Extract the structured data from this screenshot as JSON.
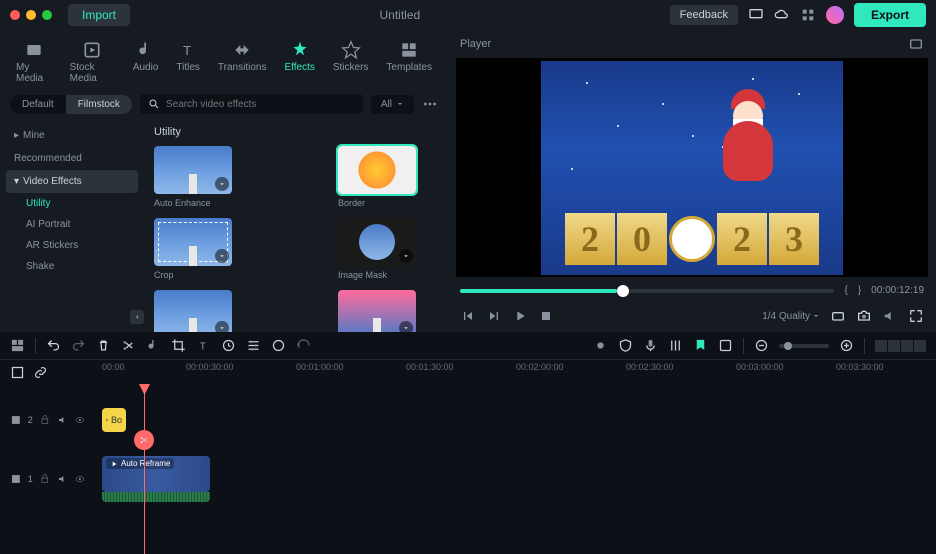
{
  "titlebar": {
    "import": "Import",
    "title": "Untitled",
    "feedback": "Feedback",
    "export": "Export"
  },
  "media_tabs": [
    {
      "label": "My Media"
    },
    {
      "label": "Stock Media"
    },
    {
      "label": "Audio"
    },
    {
      "label": "Titles"
    },
    {
      "label": "Transitions"
    },
    {
      "label": "Effects"
    },
    {
      "label": "Stickers"
    },
    {
      "label": "Templates"
    }
  ],
  "subbar": {
    "default": "Default",
    "filmstock": "Filmstock",
    "search_placeholder": "Search video effects",
    "filter": "All"
  },
  "sidebar": {
    "items": [
      "Mine",
      "Recommended",
      "Video Effects"
    ],
    "subs": [
      "Utility",
      "AI Portrait",
      "AR Stickers",
      "Shake"
    ]
  },
  "section_title": "Utility",
  "thumbs": [
    {
      "label": "Auto Enhance"
    },
    {
      "label": "Border"
    },
    {
      "label": "Crop"
    },
    {
      "label": "Image Mask"
    },
    {
      "label": ""
    },
    {
      "label": ""
    }
  ],
  "player": {
    "header": "Player",
    "braces_open": "{",
    "braces_close": "}",
    "timecode": "00:00:12:19",
    "quality": "1/4 Quality",
    "year_digits": [
      "2",
      "0",
      "clock",
      "2",
      "3"
    ]
  },
  "ruler": [
    "00:00",
    "00:00:30:00",
    "00:01:00:00",
    "00:01:30:00",
    "00:02:00:00",
    "00:02:30:00",
    "00:03:00:00",
    "00:03:30:00"
  ],
  "tracks": {
    "t2": "2",
    "t1": "1",
    "border_label": "Bo",
    "video_label": "Auto Reframe"
  }
}
